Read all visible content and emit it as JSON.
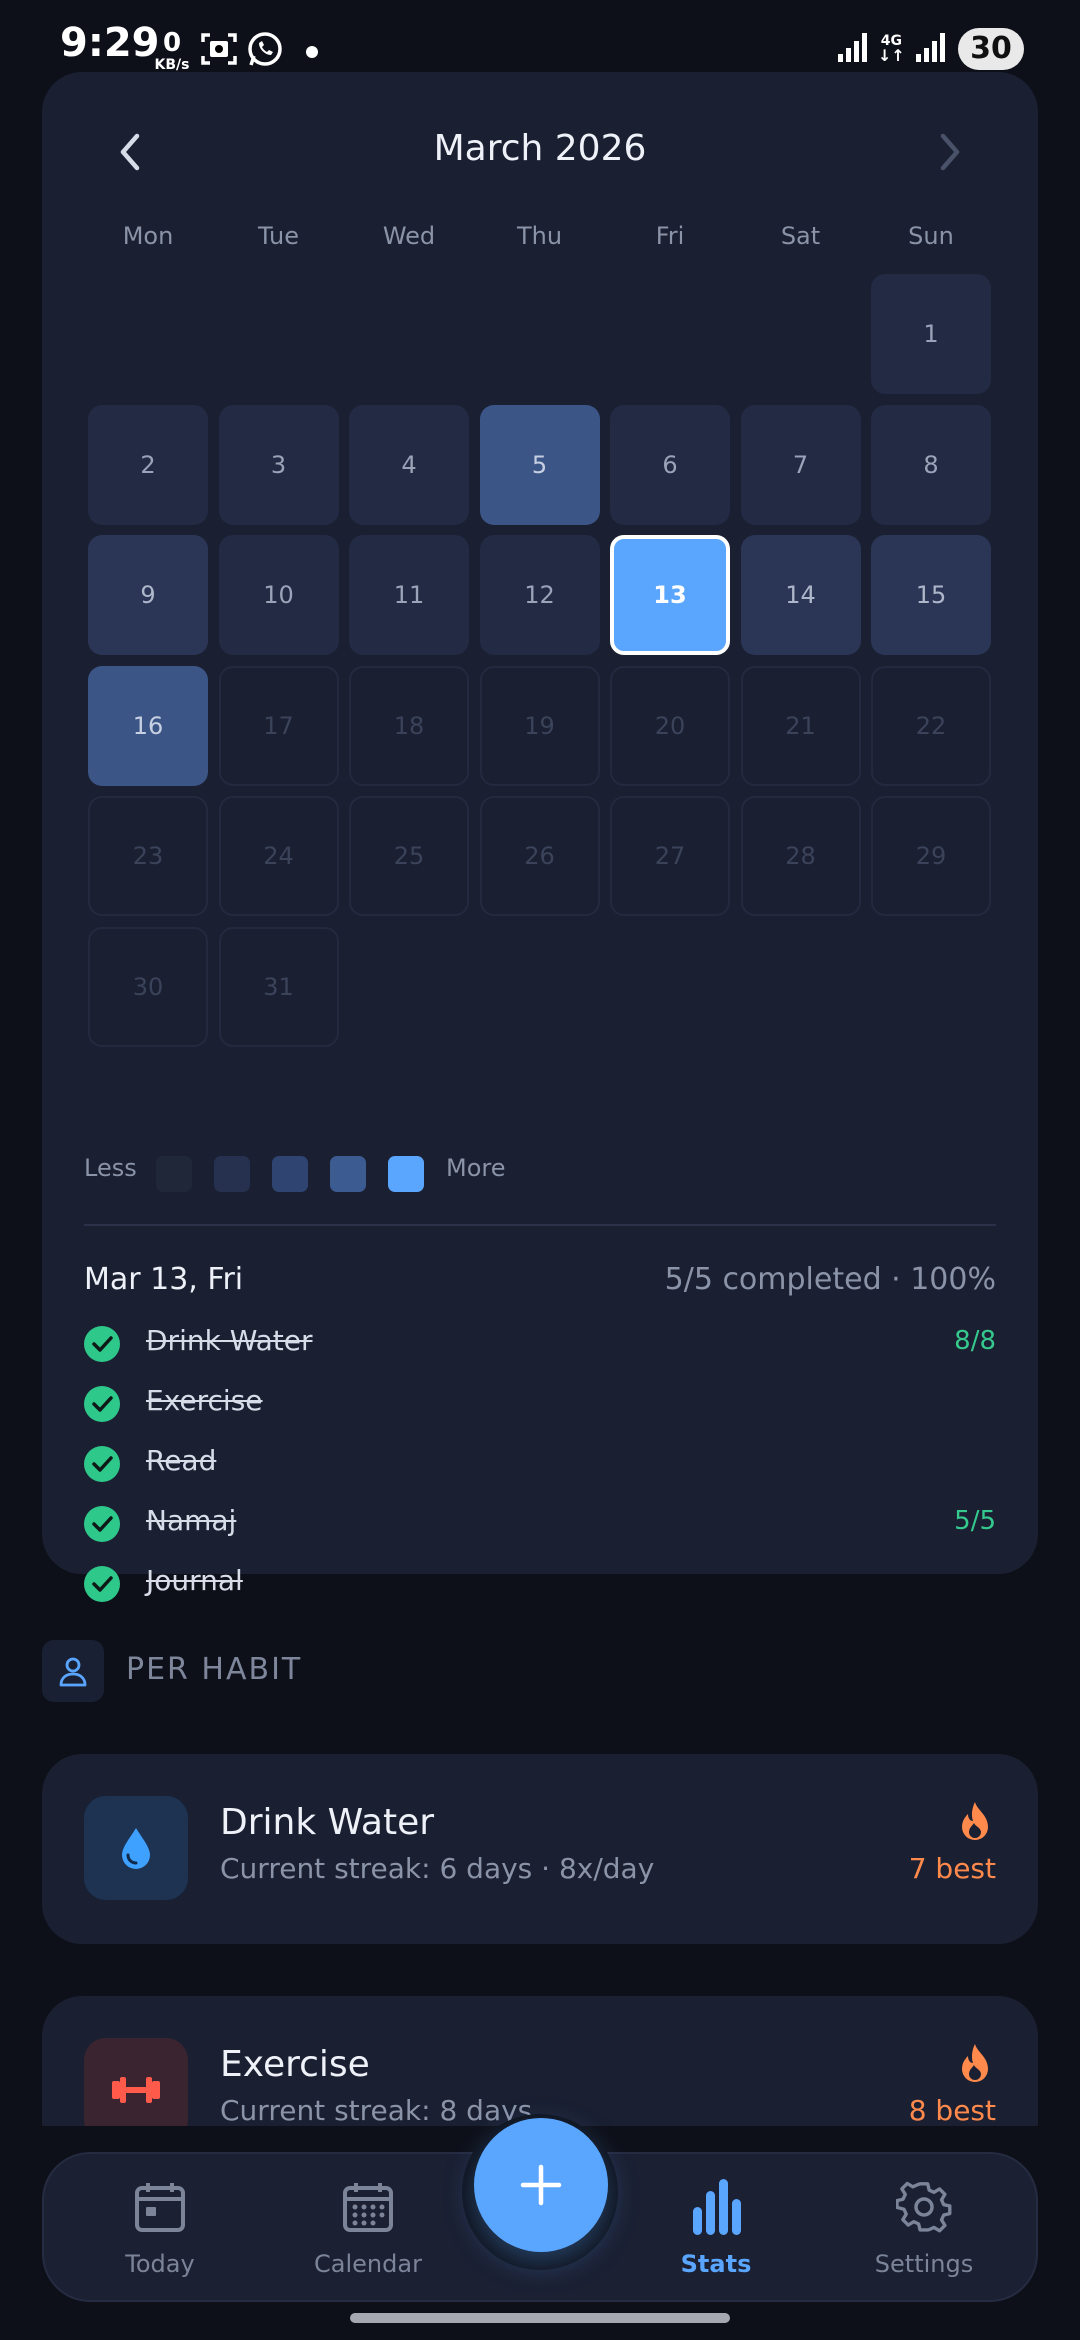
{
  "status_bar": {
    "time": "9:29",
    "net_speed_value": "0",
    "net_speed_unit": "KB/s",
    "network_type": "4G",
    "battery": "30"
  },
  "calendar": {
    "month_title": "March 2026",
    "weekdays": [
      "Mon",
      "Tue",
      "Wed",
      "Thu",
      "Fri",
      "Sat",
      "Sun"
    ],
    "days": [
      {
        "label": "1",
        "level": 1
      },
      {
        "label": "2",
        "level": 1
      },
      {
        "label": "3",
        "level": 1
      },
      {
        "label": "4",
        "level": 1
      },
      {
        "label": "5",
        "level": 3
      },
      {
        "label": "6",
        "level": 1
      },
      {
        "label": "7",
        "level": 1
      },
      {
        "label": "8",
        "level": 1
      },
      {
        "label": "9",
        "level": 2
      },
      {
        "label": "10",
        "level": 1
      },
      {
        "label": "11",
        "level": 1
      },
      {
        "label": "12",
        "level": 1
      },
      {
        "label": "13",
        "level": 4,
        "selected": true
      },
      {
        "label": "14",
        "level": 2
      },
      {
        "label": "15",
        "level": 2
      },
      {
        "label": "16",
        "level": 3
      },
      {
        "label": "17",
        "future": true
      },
      {
        "label": "18",
        "future": true
      },
      {
        "label": "19",
        "future": true
      },
      {
        "label": "20",
        "future": true
      },
      {
        "label": "21",
        "future": true
      },
      {
        "label": "22",
        "future": true
      },
      {
        "label": "23",
        "future": true
      },
      {
        "label": "24",
        "future": true
      },
      {
        "label": "25",
        "future": true
      },
      {
        "label": "26",
        "future": true
      },
      {
        "label": "27",
        "future": true
      },
      {
        "label": "28",
        "future": true
      },
      {
        "label": "29",
        "future": true
      },
      {
        "label": "30",
        "future": true
      },
      {
        "label": "31",
        "future": true
      }
    ],
    "legend": {
      "less_label": "Less",
      "more_label": "More",
      "colors": [
        "#1f2739",
        "#263150",
        "#2f4470",
        "#3c5b91",
        "#5aa6ff"
      ]
    }
  },
  "day_detail": {
    "date": "Mar 13, Fri",
    "summary": "5/5 completed · 100%",
    "habits": [
      {
        "name": "Drink Water",
        "count": "8/8"
      },
      {
        "name": "Exercise",
        "count": ""
      },
      {
        "name": "Read",
        "count": ""
      },
      {
        "name": "Namaj",
        "count": "5/5"
      },
      {
        "name": "Journal",
        "count": ""
      }
    ]
  },
  "per_habit": {
    "section_title": "PER HABIT",
    "items": [
      {
        "title": "Drink Water",
        "subtitle": "Current streak: 6 days · 8x/day",
        "best": "7 best",
        "icon": "water-drop-icon"
      },
      {
        "title": "Exercise",
        "subtitle": "Current streak: 8 days",
        "best": "8 best",
        "icon": "dumbbell-icon"
      }
    ]
  },
  "bottom_nav": {
    "items": [
      {
        "label": "Today",
        "icon": "calendar-day-icon"
      },
      {
        "label": "Calendar",
        "icon": "calendar-grid-icon"
      },
      {
        "label": "Stats",
        "icon": "bar-chart-icon",
        "active": true
      },
      {
        "label": "Settings",
        "icon": "gear-icon"
      }
    ]
  },
  "colors": {
    "accent": "#5aa6ff",
    "success": "#2ec98a",
    "streak": "#ff8a4c",
    "card": "#1a1f31",
    "background": "#0e1019"
  }
}
